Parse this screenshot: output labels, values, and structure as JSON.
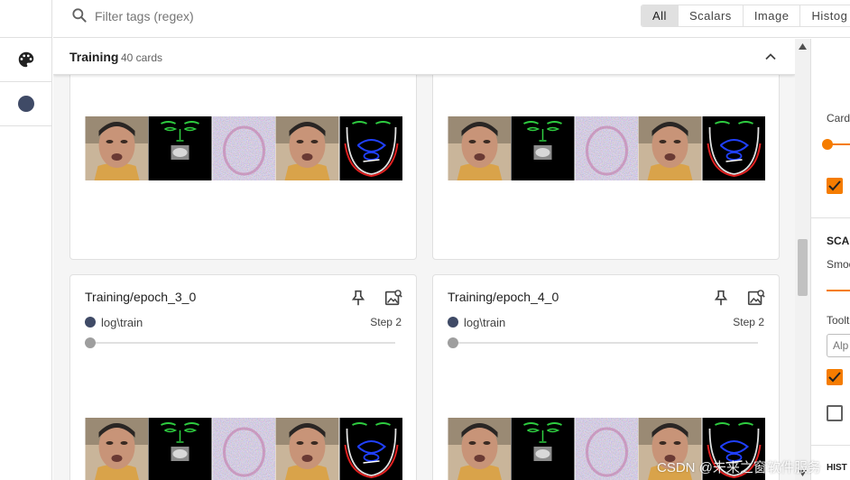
{
  "search": {
    "placeholder": "Filter tags (regex)",
    "icon": "search-icon"
  },
  "type_tabs": [
    {
      "label": "All",
      "active": true
    },
    {
      "label": "Scalars",
      "active": false
    },
    {
      "label": "Image",
      "active": false
    },
    {
      "label": "Histog",
      "active": false
    }
  ],
  "left_rail": {
    "palette_icon": "palette-icon",
    "theme_color": "#3f4a66"
  },
  "group": {
    "title": "Training",
    "count": "40 cards",
    "icon": "chevron-up-icon"
  },
  "cards": [
    {
      "title": "",
      "run": "",
      "step": ""
    },
    {
      "title": "",
      "run": "",
      "step": ""
    },
    {
      "title": "Training/epoch_3_0",
      "run": "log\\train",
      "step": "Step 2",
      "run_color": "#3f4a66",
      "pin_icon": "pin-icon",
      "image_icon": "image-settings-icon"
    },
    {
      "title": "Training/epoch_4_0",
      "run": "log\\train",
      "step": "Step 2",
      "run_color": "#3f4a66",
      "pin_icon": "pin-icon",
      "image_icon": "image-settings-icon"
    }
  ],
  "settings": {
    "card_label": "Card",
    "scalars_head": "SCA",
    "smoothing_label": "Smoo",
    "tooltip_label": "Toolt",
    "tooltip_value": "Alp",
    "histograms_head": "HIST",
    "accent": "#f57c00"
  },
  "watermark": "CSDN @未来之窗软件服务"
}
